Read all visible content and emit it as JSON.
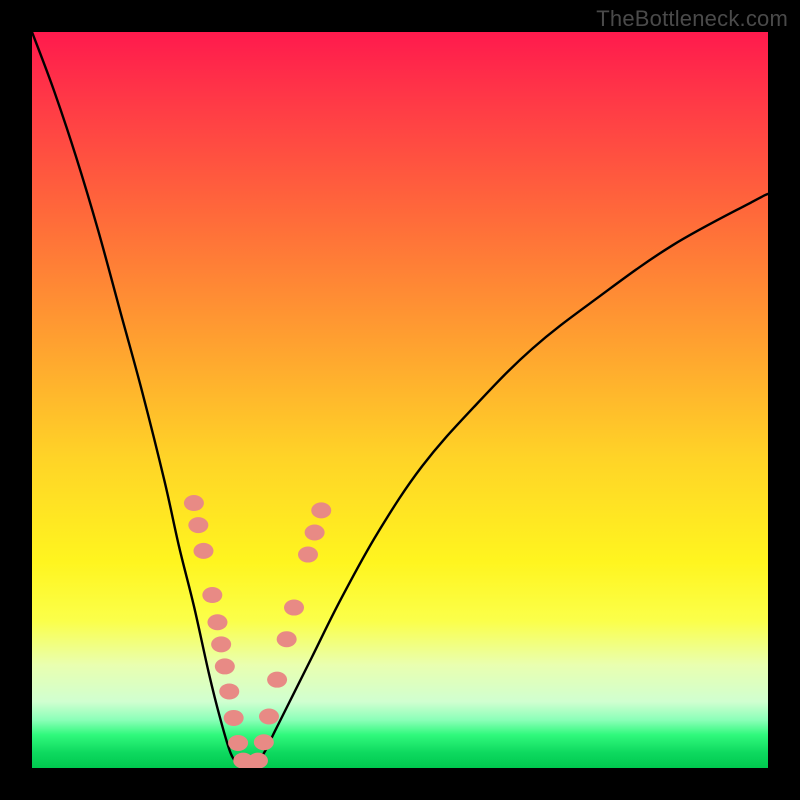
{
  "watermark": "TheBottleneck.com",
  "colors": {
    "frame": "#000000",
    "curve": "#000000",
    "marker_fill": "#e88a85",
    "marker_stroke": "#cf6c65",
    "gradient_stops": [
      "#ff1a4d",
      "#ff6a3a",
      "#ffd427",
      "#fbff4a",
      "#30f97c",
      "#00c94f"
    ]
  },
  "chart_data": {
    "type": "line",
    "title": "",
    "xlabel": "",
    "ylabel": "",
    "xlim": [
      0,
      100
    ],
    "ylim": [
      0,
      100
    ],
    "grid": false,
    "legend": false,
    "series": [
      {
        "name": "left-branch",
        "x": [
          0,
          3,
          6,
          9,
          12,
          15,
          18,
          20,
          22,
          24,
          25.5,
          27,
          28.2
        ],
        "y": [
          100,
          92,
          83,
          73,
          62,
          51,
          39,
          30,
          22,
          13,
          7,
          2,
          0.3
        ]
      },
      {
        "name": "right-branch",
        "x": [
          30.2,
          31.5,
          33,
          35,
          38,
          42,
          47,
          53,
          60,
          68,
          77,
          87,
          98,
          100
        ],
        "y": [
          0.3,
          2,
          5,
          9,
          15,
          23,
          32,
          41,
          49,
          57,
          64,
          71,
          77,
          78
        ]
      },
      {
        "name": "valley-floor",
        "x": [
          28.2,
          29.2,
          30.2
        ],
        "y": [
          0.3,
          0.2,
          0.3
        ]
      }
    ],
    "markers": {
      "name": "highlighted-points",
      "points": [
        {
          "x": 22.0,
          "y": 36.0
        },
        {
          "x": 22.6,
          "y": 33.0
        },
        {
          "x": 23.3,
          "y": 29.5
        },
        {
          "x": 24.5,
          "y": 23.5
        },
        {
          "x": 25.2,
          "y": 19.8
        },
        {
          "x": 25.7,
          "y": 16.8
        },
        {
          "x": 26.2,
          "y": 13.8
        },
        {
          "x": 26.8,
          "y": 10.4
        },
        {
          "x": 27.4,
          "y": 6.8
        },
        {
          "x": 28.0,
          "y": 3.4
        },
        {
          "x": 28.7,
          "y": 1.0
        },
        {
          "x": 29.7,
          "y": 0.5
        },
        {
          "x": 30.7,
          "y": 1.0
        },
        {
          "x": 31.5,
          "y": 3.5
        },
        {
          "x": 32.2,
          "y": 7.0
        },
        {
          "x": 33.3,
          "y": 12.0
        },
        {
          "x": 34.6,
          "y": 17.5
        },
        {
          "x": 35.6,
          "y": 21.8
        },
        {
          "x": 37.5,
          "y": 29.0
        },
        {
          "x": 38.4,
          "y": 32.0
        },
        {
          "x": 39.3,
          "y": 35.0
        }
      ]
    }
  }
}
